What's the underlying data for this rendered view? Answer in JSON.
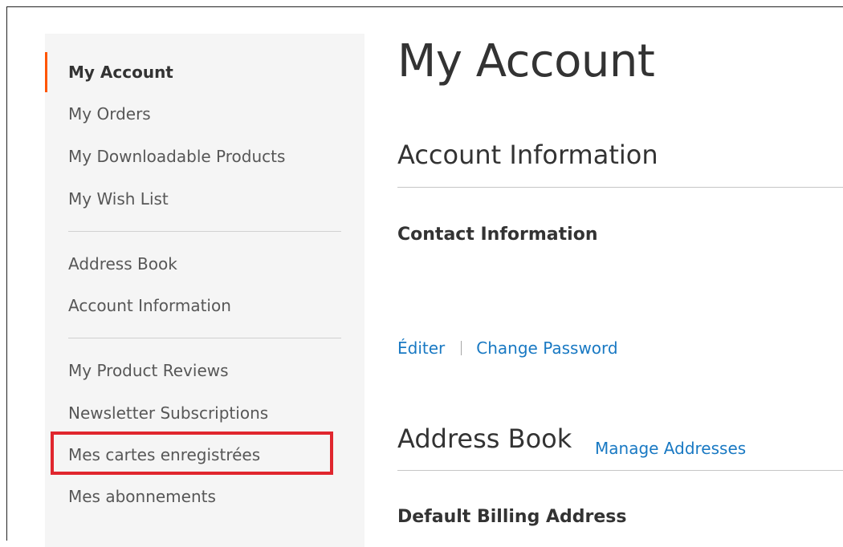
{
  "sidebar": {
    "items": [
      {
        "label": "My Account",
        "current": true
      },
      {
        "label": "My Orders"
      },
      {
        "label": "My Downloadable Products"
      },
      {
        "label": "My Wish List"
      },
      {
        "label": "Address Book"
      },
      {
        "label": "Account Information"
      },
      {
        "label": "My Product Reviews"
      },
      {
        "label": "Newsletter Subscriptions"
      },
      {
        "label": "Mes cartes enregistrées"
      },
      {
        "label": "Mes abonnements"
      }
    ]
  },
  "main": {
    "title": "My Account",
    "account_info": {
      "title": "Account Information",
      "contact_title": "Contact Information",
      "edit_label": "Éditer",
      "change_password_label": "Change Password"
    },
    "address_book": {
      "title": "Address Book",
      "manage_label": "Manage Addresses",
      "billing_title": "Default Billing Address"
    }
  },
  "colors": {
    "current_indicator": "#ff5501",
    "highlight": "#e0262e",
    "link": "#1979c3"
  }
}
